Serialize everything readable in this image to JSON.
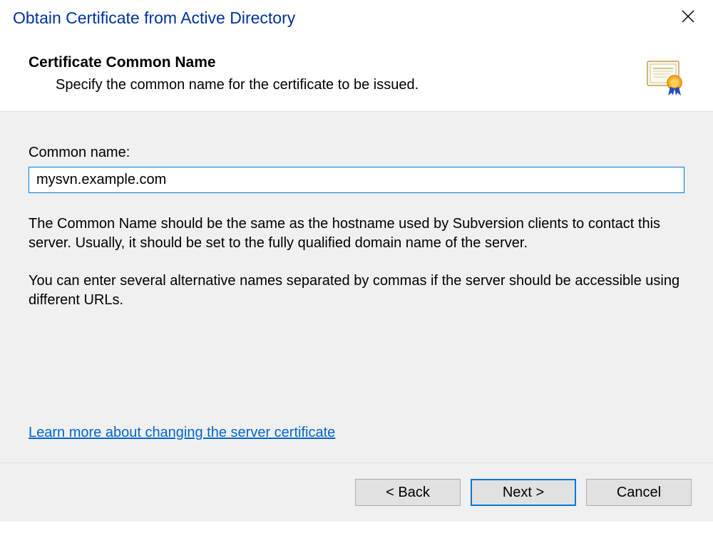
{
  "titlebar": {
    "title": "Obtain Certificate from Active Directory"
  },
  "header": {
    "title": "Certificate Common Name",
    "subtitle": "Specify the common name for the certificate to be issued."
  },
  "content": {
    "field_label": "Common name:",
    "field_value": "mysvn.example.com",
    "help_text_1": "The Common Name should be the same as the hostname used by Subversion clients to contact this server. Usually, it should be set to the fully qualified domain name of the server.",
    "help_text_2": "You can enter several alternative names separated by commas if the server should be accessible using different URLs.",
    "learn_link": "Learn more about changing the server certificate"
  },
  "footer": {
    "back": "< Back",
    "next": "Next >",
    "cancel": "Cancel"
  }
}
